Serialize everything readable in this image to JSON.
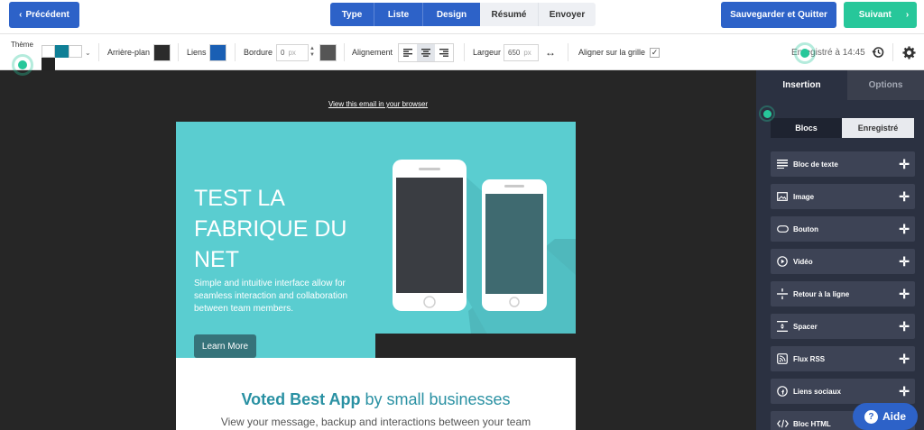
{
  "topbar": {
    "prev_label": "Précédent",
    "steps": [
      "Type",
      "Liste",
      "Design",
      "Résumé",
      "Envoyer"
    ],
    "save_label": "Sauvegarder et Quitter",
    "next_label": "Suivant"
  },
  "toolbar": {
    "theme_label": "Thème",
    "background_label": "Arrière-plan",
    "links_label": "Liens",
    "border_label": "Bordure",
    "border_value": "0",
    "border_unit": "px",
    "alignment_label": "Alignement",
    "width_label": "Largeur",
    "width_value": "650",
    "width_unit": "px",
    "grid_label": "Aligner sur la grille",
    "saved_text": "Enregistré à 14:45",
    "colors": {
      "background": "#2b2b2b",
      "links": "#1a5fb4",
      "border": "#555555"
    }
  },
  "canvas": {
    "view_link": "View this email in your browser",
    "hero_title": "TEST LA FABRIQUE DU NET",
    "hero_subtitle": "Simple and intuitive interface allow for seamless interaction and collaboration between team members.",
    "hero_button": "Learn More",
    "voted_bold": "Voted Best App",
    "voted_rest": " by small businesses",
    "voted_sub": "View your message, backup and interactions between your team"
  },
  "panel": {
    "tabs": [
      "Insertion",
      "Options"
    ],
    "subtabs": [
      "Blocs",
      "Enregistré"
    ],
    "blocks": [
      {
        "label": "Bloc de texte",
        "icon": "text-lines-icon"
      },
      {
        "label": "Image",
        "icon": "image-icon"
      },
      {
        "label": "Bouton",
        "icon": "button-icon"
      },
      {
        "label": "Vidéo",
        "icon": "play-icon"
      },
      {
        "label": "Retour à la ligne",
        "icon": "divider-icon"
      },
      {
        "label": "Spacer",
        "icon": "spacer-icon"
      },
      {
        "label": "Flux RSS",
        "icon": "rss-icon"
      },
      {
        "label": "Liens sociaux",
        "icon": "facebook-icon"
      },
      {
        "label": "Bloc HTML",
        "icon": "code-icon"
      }
    ]
  },
  "help": {
    "label": "Aide",
    "glyph": "?"
  }
}
